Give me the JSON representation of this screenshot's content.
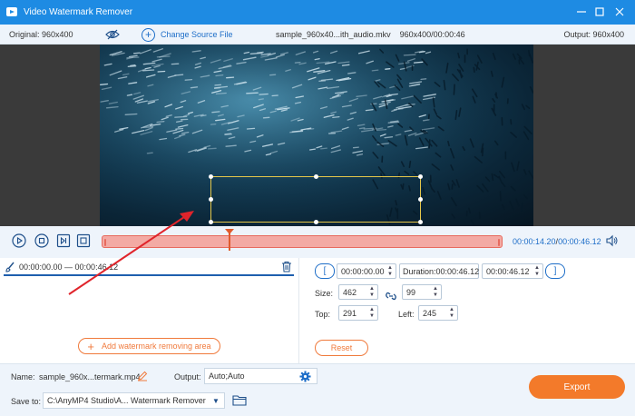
{
  "window": {
    "title": "Video Watermark Remover",
    "minimize_icon": "minimize-icon",
    "maximize_icon": "maximize-icon",
    "close_icon": "close-icon"
  },
  "infobar": {
    "original": "Original: 960x400",
    "change_source": "Change Source File",
    "file_name": "sample_960x40...ith_audio.mkv",
    "file_info": "960x400/00:00:46",
    "output": "Output: 960x400"
  },
  "playback": {
    "current_time": "00:00:14.20",
    "separator": "/",
    "total_time": "00:00:46.12",
    "progress_fraction": 0.3
  },
  "segment": {
    "range": "00:00:00.00 — 00:00:46.12"
  },
  "add_area_label": "Add watermark removing area",
  "right": {
    "start_bracket": "[",
    "end_bracket": "]",
    "start_time": "00:00:00.00",
    "duration_label": "Duration:",
    "duration": "00:00:46.12",
    "end_time": "00:00:46.12",
    "size_label": "Size:",
    "width": "462",
    "height": "99",
    "top_label": "Top:",
    "top": "291",
    "left_label": "Left:",
    "left": "245",
    "reset_label": "Reset"
  },
  "bottom": {
    "name_label": "Name:",
    "name_value": "sample_960x...termark.mp4",
    "output_label": "Output:",
    "output_value": "Auto;Auto",
    "save_label": "Save to:",
    "save_value": "C:\\AnyMP4 Studio\\A... Watermark Remover",
    "export_label": "Export"
  },
  "colors": {
    "titlebar": "#1e8be3",
    "accent": "#f37a2a",
    "timeline": "#f3aaa4",
    "link": "#1e6ec8"
  }
}
